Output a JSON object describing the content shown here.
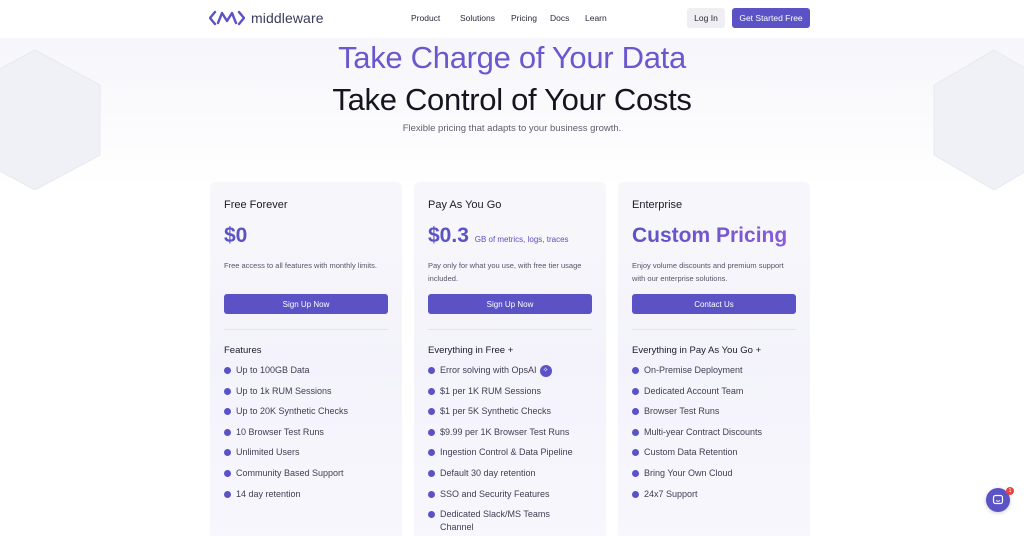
{
  "brand": {
    "name": "middleware",
    "color": "#5b52c6"
  },
  "nav": {
    "links": [
      "Product",
      "Solutions",
      "Pricing",
      "Docs",
      "Learn"
    ],
    "login": "Log In",
    "cta": "Get Started Free"
  },
  "hero": {
    "line1": "Take Charge of Your Data",
    "line2": "Take Control of Your Costs",
    "subtitle": "Flexible pricing that adapts to your business growth."
  },
  "plans": [
    {
      "title": "Free Forever",
      "price": "$0",
      "price_suffix": "",
      "description": "Free access to all features with monthly limits.",
      "button": "Sign Up Now",
      "list_heading": "Features",
      "items": [
        "Up to 100GB Data",
        "Up to 1k RUM Sessions",
        "Up to 20K Synthetic Checks",
        "10 Browser Test Runs",
        "Unlimited Users",
        "Community Based Support",
        "14 day retention"
      ]
    },
    {
      "title": "Pay As You Go",
      "price": "$0.3",
      "price_suffix": "GB of metrics, logs, traces",
      "description": "Pay only for what you use, with free tier usage included.",
      "button": "Sign Up Now",
      "list_heading": "Everything in Free +",
      "items": [
        "Error solving with OpsAI",
        "$1 per 1K RUM Sessions",
        "$1 per 5K Synthetic Checks",
        "$9.99 per 1K Browser Test Runs",
        "Ingestion Control & Data Pipeline",
        "Default 30 day retention",
        "SSO and Security Features",
        "Dedicated Slack/MS Teams Channel"
      ]
    },
    {
      "title": "Enterprise",
      "price": "Custom Pricing",
      "price_suffix": "",
      "description": "Enjoy volume discounts and premium support with our enterprise solutions.",
      "button": "Contact Us",
      "list_heading": "Everything in Pay As You Go +",
      "items": [
        "On-Premise Deployment",
        "Dedicated Account Team",
        "Browser Test Runs",
        "Multi-year Contract Discounts",
        "Custom Data Retention",
        "Bring Your Own Cloud",
        "24x7 Support"
      ]
    }
  ],
  "chat": {
    "icon": "chat-icon",
    "badge": "1"
  }
}
